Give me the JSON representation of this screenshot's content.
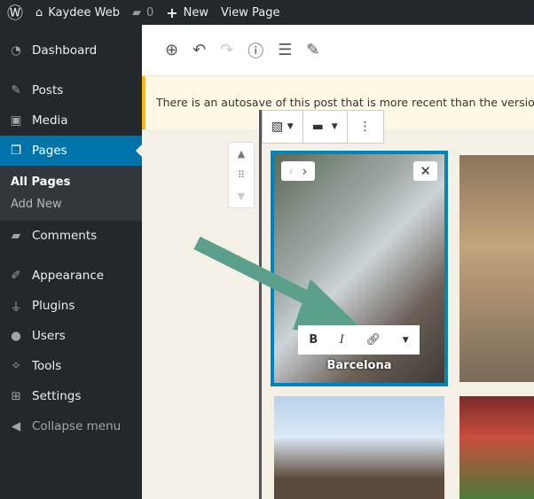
{
  "admin_bar": {
    "site_name": "Kaydee Web",
    "comments_count": "0",
    "new_label": "New",
    "view_page_label": "View Page"
  },
  "sidebar": {
    "items": [
      {
        "label": "Dashboard",
        "icon": "dashboard-icon"
      },
      {
        "label": "Posts",
        "icon": "pin-icon"
      },
      {
        "label": "Media",
        "icon": "media-icon"
      },
      {
        "label": "Pages",
        "icon": "pages-icon"
      },
      {
        "label": "Comments",
        "icon": "comment-icon"
      },
      {
        "label": "Appearance",
        "icon": "brush-icon"
      },
      {
        "label": "Plugins",
        "icon": "plugin-icon"
      },
      {
        "label": "Users",
        "icon": "user-icon"
      },
      {
        "label": "Tools",
        "icon": "wrench-icon"
      },
      {
        "label": "Settings",
        "icon": "settings-icon"
      },
      {
        "label": "Collapse menu",
        "icon": "collapse-icon"
      }
    ],
    "submenu": [
      "All Pages",
      "Add New"
    ]
  },
  "notice": {
    "text": "There is an autosave of this post that is more recent than the version below."
  },
  "gallery": {
    "caption": "Barcelona"
  },
  "colors": {
    "accent": "#0073aa",
    "arrow": "#5aa08c"
  }
}
